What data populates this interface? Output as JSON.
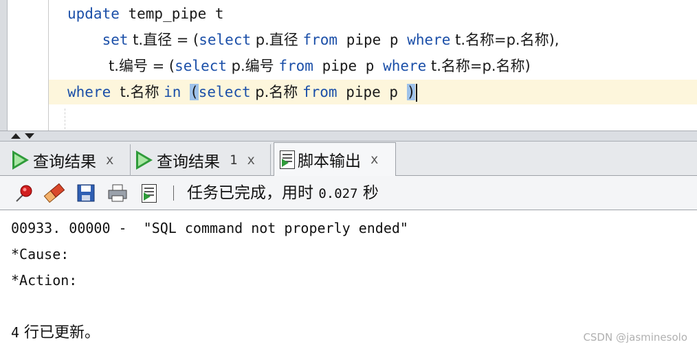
{
  "editor": {
    "lines": [
      {
        "a": "update",
        "b": " temp_pipe t"
      },
      {
        "a": "    set",
        "b": " t.直径 = (",
        "c": "select",
        "d": " p.直径 ",
        "e": "from",
        "f": " pipe p ",
        "g": "where",
        "h": " t.名称=p.名称),"
      },
      {
        "b": "         t.编号 = (",
        "c": "select",
        "d": " p.编号 ",
        "e": "from",
        "f": " pipe p ",
        "g": "where",
        "h": " t.名称=p.名称)"
      },
      {
        "a": "where",
        "b": "  t.名称 ",
        "i": "in",
        "b2": " ",
        "br1": "(",
        "c": "select",
        "d": " p.名称 ",
        "e": "from",
        "f": " pipe p ",
        "br2": ")"
      }
    ]
  },
  "tabs": [
    {
      "label": "查询结果",
      "number": "",
      "close": "x"
    },
    {
      "label": "查询结果",
      "number": "1",
      "close": "x"
    },
    {
      "label": "脚本输出",
      "number": "",
      "close": "x"
    }
  ],
  "toolbar": {
    "icons": [
      "pin-icon",
      "eraser-icon",
      "save-icon",
      "print-icon",
      "script-output-icon"
    ],
    "status_prefix": "任务已完成，用时 ",
    "status_time": "0.027",
    "status_suffix": " 秒"
  },
  "output": {
    "line1": "00933. 00000 -  \"SQL command not properly ended\"",
    "line2": "*Cause:",
    "line3": "*Action:",
    "line4_num": "4",
    "line4_text": " 行已更新。"
  },
  "watermark": "CSDN @jasminesolo",
  "colors": {
    "keyword": "#1b4fa8",
    "current_line": "#fdf6dc",
    "bracket_highlight": "#9ec2ea",
    "run_green": "#2f9b3a"
  }
}
